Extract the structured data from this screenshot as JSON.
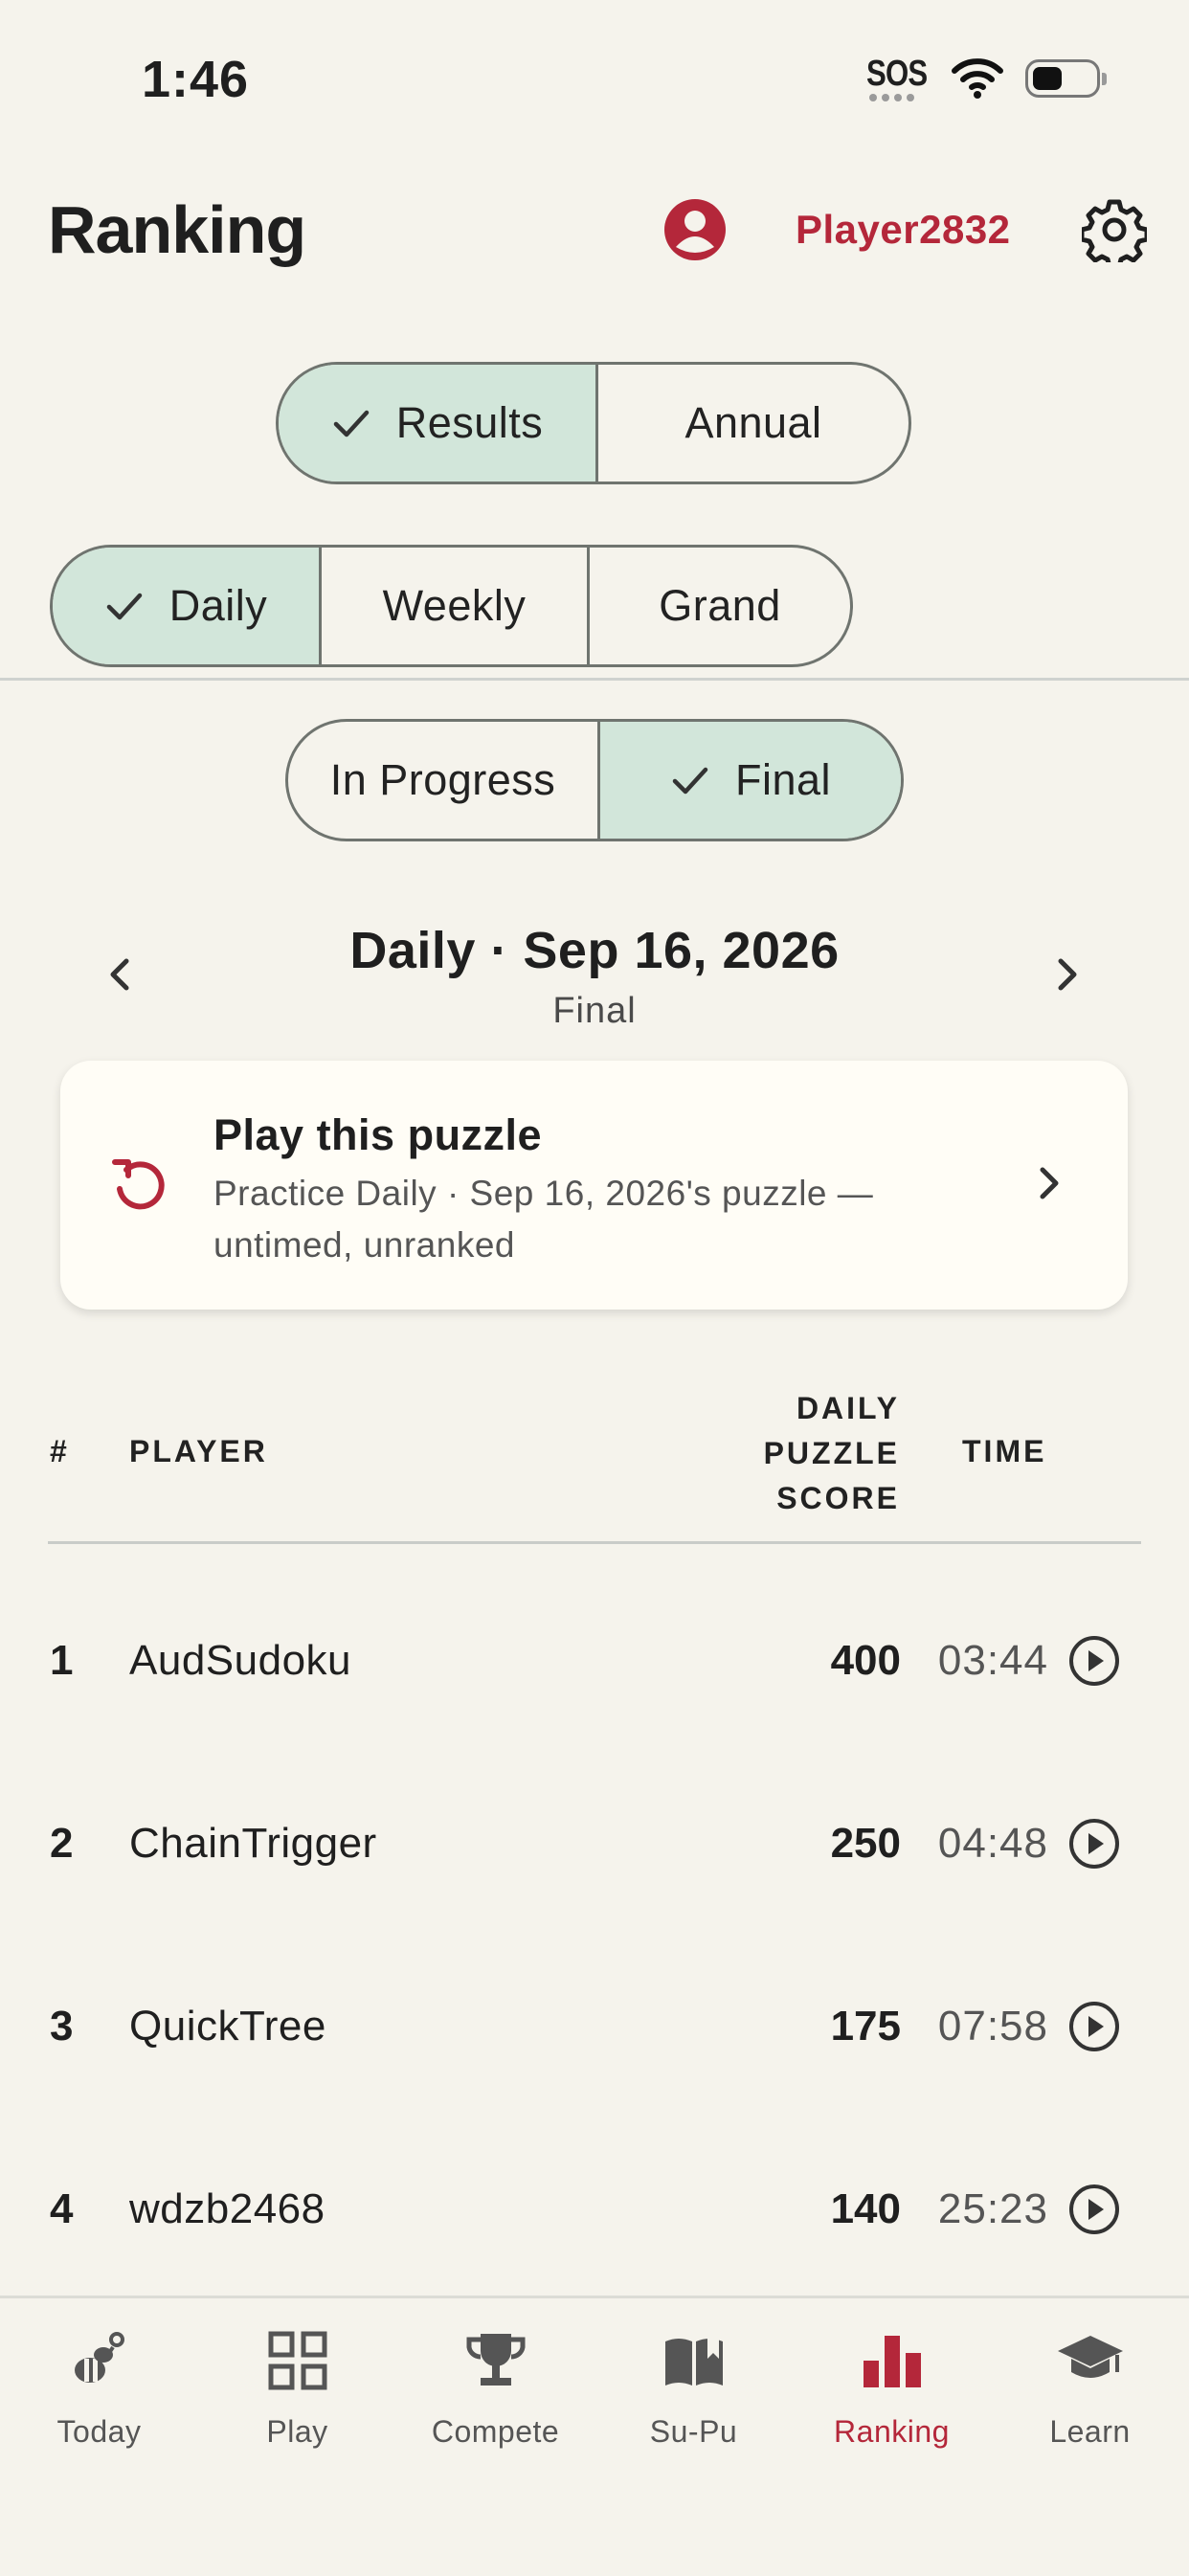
{
  "status_bar": {
    "time": "1:46",
    "sos": "SOS"
  },
  "header": {
    "title": "Ranking",
    "username": "Player2832"
  },
  "view_toggle": {
    "options": [
      "Results",
      "Annual"
    ],
    "selected": "Results"
  },
  "period_toggle": {
    "options": [
      "Daily",
      "Weekly",
      "Grand"
    ],
    "selected": "Daily"
  },
  "state_toggle": {
    "options": [
      "In Progress",
      "Final"
    ],
    "selected": "Final"
  },
  "date_nav": {
    "title": "Daily · Sep 16, 2026",
    "subtitle": "Final"
  },
  "practice_card": {
    "title": "Play this puzzle",
    "subtitle": "Practice Daily · Sep 16, 2026's puzzle — untimed, unranked"
  },
  "table": {
    "headers": {
      "rank": "#",
      "player": "PLAYER",
      "score_line1": "DAILY",
      "score_line2": "PUZZLE",
      "score_line3": "SCORE",
      "time": "TIME"
    },
    "rows": [
      {
        "rank": "1",
        "player": "AudSudoku",
        "score": "400",
        "time": "03:44"
      },
      {
        "rank": "2",
        "player": "ChainTrigger",
        "score": "250",
        "time": "04:48"
      },
      {
        "rank": "3",
        "player": "QuickTree",
        "score": "175",
        "time": "07:58"
      },
      {
        "rank": "4",
        "player": "wdzb2468",
        "score": "140",
        "time": "25:23"
      }
    ]
  },
  "tab_bar": {
    "items": [
      {
        "label": "Today",
        "icon": "bee-icon"
      },
      {
        "label": "Play",
        "icon": "grid-icon"
      },
      {
        "label": "Compete",
        "icon": "trophy-icon"
      },
      {
        "label": "Su-Pu",
        "icon": "book-icon"
      },
      {
        "label": "Ranking",
        "icon": "bar-chart-icon"
      },
      {
        "label": "Learn",
        "icon": "graduation-cap-icon"
      }
    ],
    "active": "Ranking"
  },
  "colors": {
    "accent": "#b4273a",
    "selected_segment": "#d2e6da",
    "background": "#f5f3ec",
    "card": "#fffdf6"
  }
}
